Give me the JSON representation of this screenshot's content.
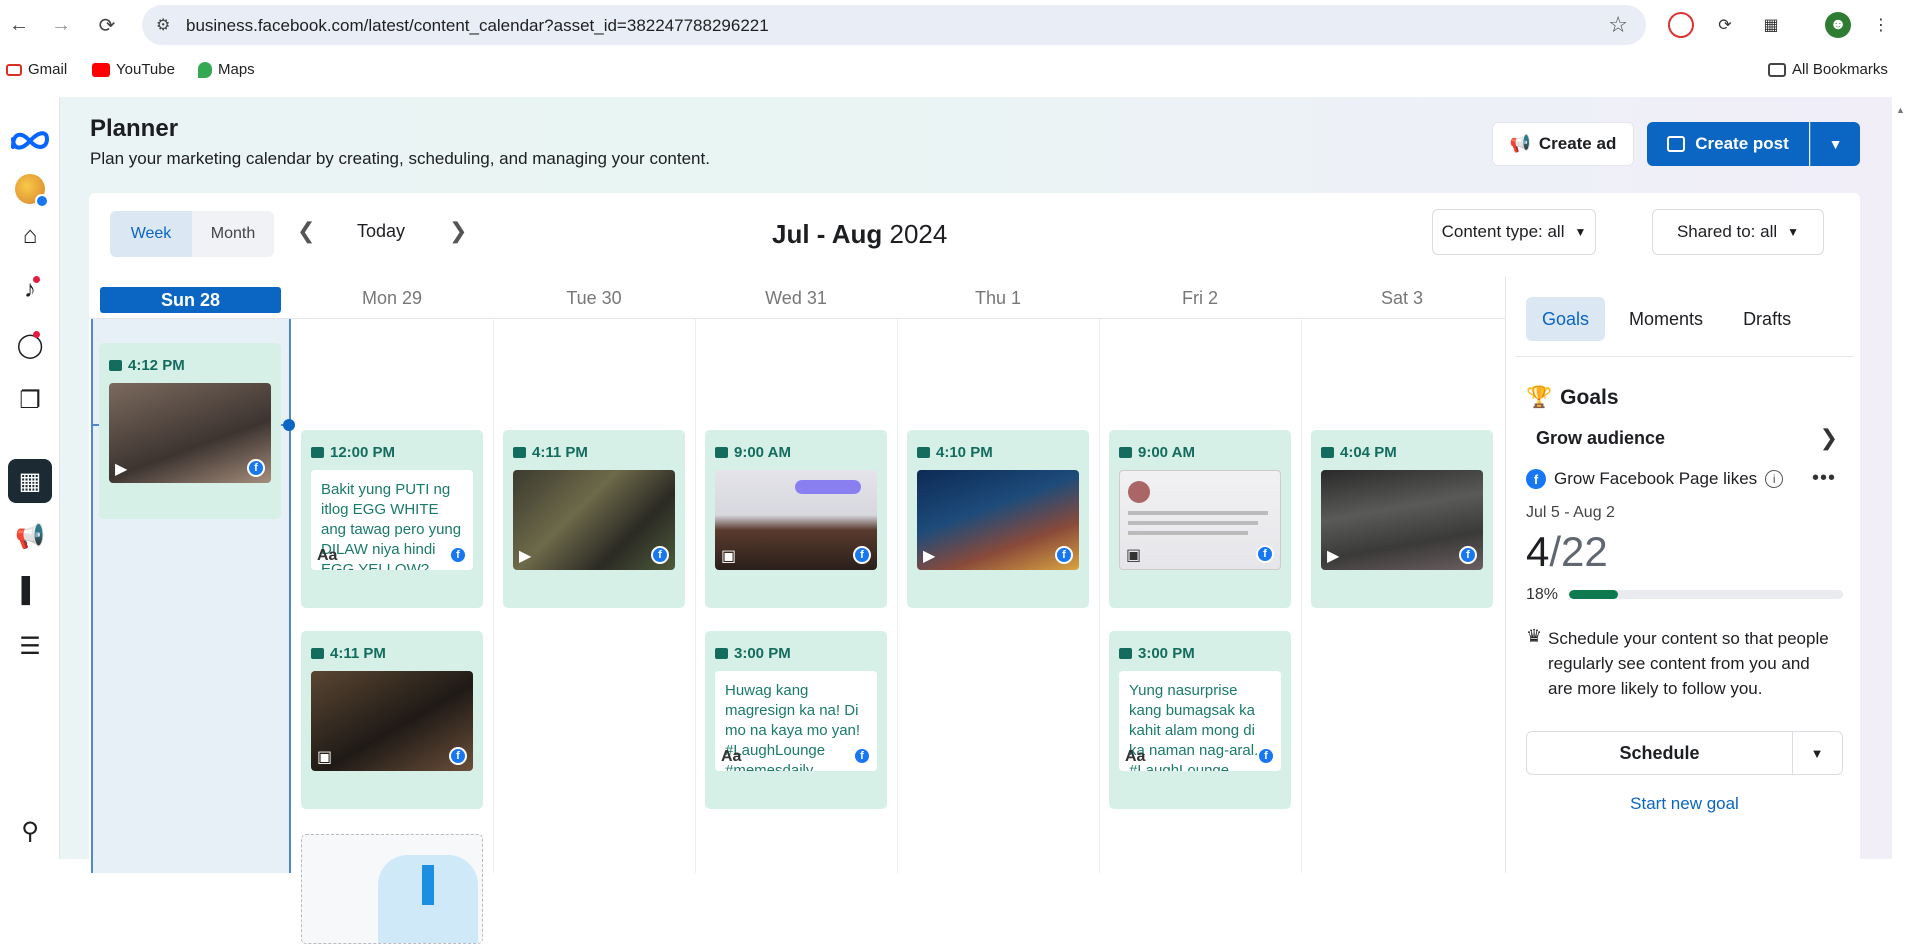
{
  "browser": {
    "url": "business.facebook.com/latest/content_calendar?asset_id=382247788296221",
    "bookmarks": [
      "Gmail",
      "YouTube",
      "Maps"
    ],
    "all_bookmarks": "All Bookmarks"
  },
  "header": {
    "title": "Planner",
    "subtitle": "Plan your marketing calendar by creating, scheduling, and managing your content.",
    "create_ad": "Create ad",
    "create_post": "Create post"
  },
  "calendar": {
    "view_week": "Week",
    "view_month": "Month",
    "today": "Today",
    "range_bold": "Jul - Aug",
    "range_year": "2024",
    "content_type": "Content type: all",
    "shared_to": "Shared to: all",
    "days": [
      "Sun 28",
      "Mon 29",
      "Tue 30",
      "Wed 31",
      "Thu 1",
      "Fri 2",
      "Sat 3"
    ],
    "posts": {
      "sun_1": {
        "time": "4:12 PM"
      },
      "mon_1": {
        "time": "12:00 PM",
        "text": "Bakit yung PUTI ng itlog EGG WHITE ang tawag pero yung DILAW niya hindi EGG YELLOW?"
      },
      "mon_2": {
        "time": "4:11 PM"
      },
      "tue_1": {
        "time": "4:11 PM"
      },
      "wed_1": {
        "time": "9:00 AM"
      },
      "wed_2": {
        "time": "3:00 PM",
        "text": "Huwag kang magresign ka na! Di mo na kaya mo yan! #LaughLounge #memesdaily"
      },
      "thu_1": {
        "time": "4:10 PM"
      },
      "fri_1": {
        "time": "9:00 AM"
      },
      "fri_2": {
        "time": "3:00 PM",
        "text": "Yung nasurprise kang bumagsak ka kahit alam mong di ka naman nag-aral. #LaughLounge"
      },
      "sat_1": {
        "time": "4:04 PM"
      }
    }
  },
  "sidebar": {
    "tabs": [
      "Goals",
      "Moments",
      "Drafts"
    ],
    "goals_heading": "Goals",
    "grow_audience": "Grow audience",
    "goal_name": "Grow Facebook Page likes",
    "goal_dates": "Jul 5 - Aug 2",
    "goal_current": "4",
    "goal_target": "/22",
    "goal_percent_label": "18%",
    "goal_progress_fraction": 0.18,
    "tip": "Schedule your content so that people regularly see content from you and are more likely to follow you.",
    "schedule": "Schedule",
    "start_new_goal": "Start new goal"
  }
}
